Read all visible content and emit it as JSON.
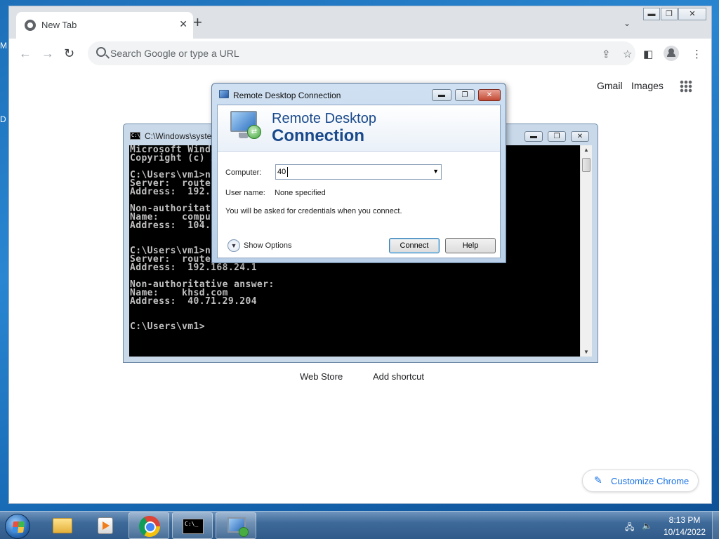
{
  "desktop": {
    "edge_letters": [
      "M",
      "D"
    ]
  },
  "chrome": {
    "tab": {
      "title": "New Tab",
      "close_glyph": "✕"
    },
    "new_tab_glyph": "+",
    "tab_search_glyph": "⌄",
    "window_controls": {
      "minimize": "▬",
      "restore": "❐",
      "close": "✕"
    },
    "omnibox": {
      "placeholder": "Search Google or type a URL"
    },
    "nav": {
      "back": "←",
      "forward": "→",
      "reload": "↻"
    },
    "toolbar_icons": {
      "share": "⇪",
      "bookmark": "☆",
      "side_panel": "◧",
      "menu": "⋮"
    },
    "ntp": {
      "gmail": "Gmail",
      "images": "Images",
      "shortcuts": [
        "Web Store",
        "Add shortcut"
      ],
      "customize_label": "Customize Chrome",
      "customize_glyph": "✎"
    }
  },
  "cmd": {
    "title": "C:\\Windows\\syste",
    "icon_text": "C:\\",
    "console_text": "Microsoft Windo\nCopyright (c) 2\n\nC:\\Users\\vm1>ns\nServer:  router\nAddress:  192.1\n\nNon-authoritati\nName:    comput\nAddress:  104.1\n\n\nC:\\Users\\vm1>ns\nServer:  router\nAddress:  192.168.24.1\n\nNon-authoritative answer:\nName:    khsd.com\nAddress:  40.71.29.204\n\n\nC:\\Users\\vm1>",
    "window_controls": {
      "minimize": "▬",
      "restore": "❐",
      "close": "✕"
    }
  },
  "rdp": {
    "title": "Remote Desktop Connection",
    "heading_line1": "Remote Desktop",
    "heading_line2": "Connection",
    "computer_label": "Computer:",
    "computer_value": "40",
    "username_label": "User name:",
    "username_value": "None specified",
    "credentials_note": "You will be asked for credentials when you connect.",
    "show_options": "Show Options",
    "connect_button": "Connect",
    "help_button": "Help",
    "window_controls": {
      "minimize": "▬",
      "restore": "❐",
      "close": "✕"
    }
  },
  "taskbar": {
    "time": "8:13 PM",
    "date": "10/14/2022",
    "cmd_icon_text": "C:\\_"
  }
}
